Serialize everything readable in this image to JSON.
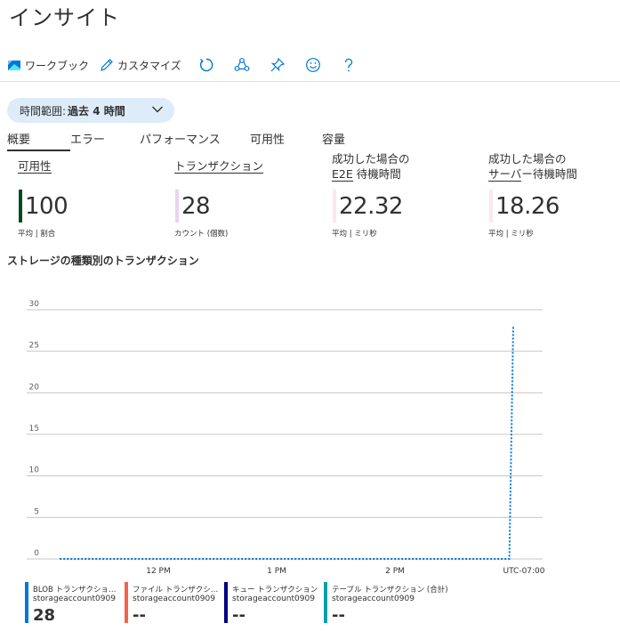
{
  "page": {
    "title": "インサイト"
  },
  "toolbar": {
    "workbook_label": "ワークブック",
    "customize_label": "カスタマイズ",
    "refresh_icon": "refresh-icon",
    "share_icon": "share-icon",
    "pin_icon": "pin-icon",
    "feedback_icon": "smiley-icon",
    "help_icon": "help-icon"
  },
  "time_range": {
    "label": "時間範囲:",
    "value": "過去 4 時間"
  },
  "tabs": [
    {
      "label": "概要",
      "active": true
    },
    {
      "label": "エラー"
    },
    {
      "label": "パフォーマンス"
    },
    {
      "label": "可用性"
    },
    {
      "label": "容量"
    }
  ],
  "metrics": [
    {
      "title_line1": "可用性",
      "value": "100",
      "sub": "平均 | 割合",
      "color": "#004b1c"
    },
    {
      "title_line1": "トランザクション",
      "value": "28",
      "sub": "カウント (個数)",
      "color": "#e8d5ee"
    },
    {
      "title_line1": "成功した場合の",
      "title_line2_ul": "E2E",
      "title_line2_rest": " 待機時間",
      "value": "22.32",
      "sub": "平均 | ミリ秒",
      "color": "#fce7f1"
    },
    {
      "title_line1": "成功した場合の",
      "title_line2_ul": "サーバ",
      "title_line2_rest": "ー待機時間",
      "value": "18.26",
      "sub": "平均 | ミリ秒",
      "color": "#fce7f1"
    }
  ],
  "chart_title": "ストレージの種類別のトランザクション",
  "chart_data": {
    "type": "line",
    "title": "ストレージの種類別のトランザクション",
    "ylim": [
      0,
      30
    ],
    "yticks": [
      "30",
      "25",
      "20",
      "15",
      "10",
      "5",
      "0"
    ],
    "xticks": [
      "12 PM",
      "1 PM",
      "2 PM",
      "UTC-07:00"
    ],
    "grid": true,
    "series": [
      {
        "name": "BLOB トランザクション (合計)",
        "color": "#0078d4",
        "style": "dotted",
        "points": [
          {
            "x": "11:10 AM",
            "y": 0
          },
          {
            "x": "2:58 PM",
            "y": 0
          },
          {
            "x": "3:00 PM",
            "y": 28
          }
        ]
      }
    ]
  },
  "legend": [
    {
      "name": "BLOB トランザクション (合計)",
      "account": "storageaccount0909",
      "value": "28",
      "color": "#0078d4"
    },
    {
      "name": "ファイル トランザクション",
      "account": "storageaccount0909",
      "value": "--",
      "color": "#f1634c"
    },
    {
      "name": "キュー トランザクション",
      "account": "storageaccount0909",
      "value": "--",
      "color": "#000080"
    },
    {
      "name": "テーブル トランザクション (合計)",
      "account": "storageaccount0909",
      "value": "--",
      "color": "#00a2ad"
    }
  ]
}
